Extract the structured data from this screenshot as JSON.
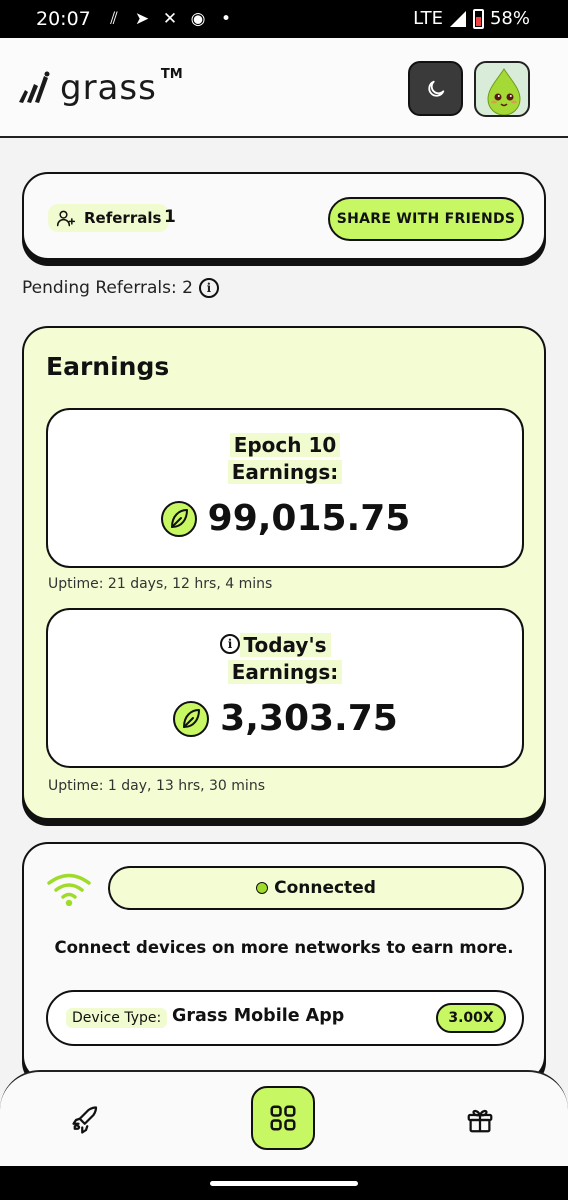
{
  "status": {
    "time": "20:07",
    "network": "LTE",
    "battery": "58%"
  },
  "header": {
    "logo_text": "grass",
    "logo_tm": "TM"
  },
  "referrals": {
    "label": "Referrals",
    "count": "1",
    "share_label": "SHARE WITH FRIENDS",
    "pending_text": "Pending Referrals: 2"
  },
  "earnings": {
    "title": "Earnings",
    "epoch": {
      "label_line1": "Epoch 10",
      "label_line2": "Earnings:",
      "value": "99,015.75",
      "uptime": "Uptime: 21 days, 12 hrs, 4 mins"
    },
    "today": {
      "label_line1": "Today's",
      "label_line2": "Earnings:",
      "value": "3,303.75",
      "uptime": "Uptime: 1 day, 13 hrs, 30 mins"
    }
  },
  "connection": {
    "status": "Connected",
    "message": "Connect devices on more networks to earn more.",
    "device_label": "Device Type:",
    "device_value": "Grass Mobile App",
    "multiplier": "3.00X"
  },
  "colors": {
    "accent": "#c8f764",
    "card_tint": "#f3fcd3",
    "label_tint": "#f1fbd0"
  },
  "icons": {
    "nav_left": "rocket-icon",
    "nav_center": "grid-icon",
    "nav_right": "gift-icon"
  }
}
